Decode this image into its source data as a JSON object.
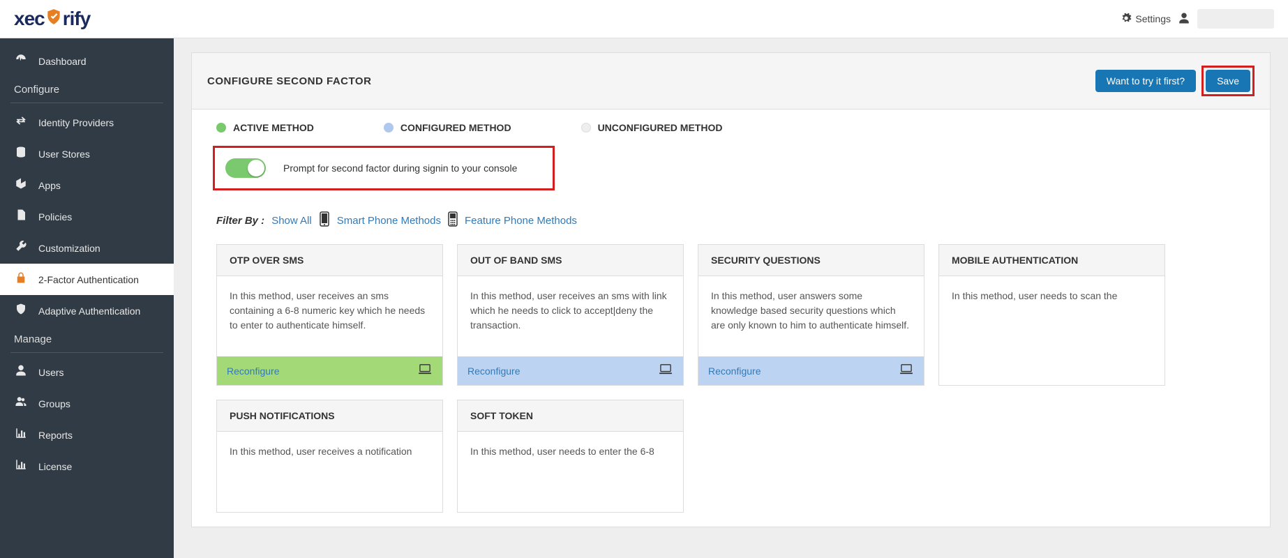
{
  "topbar": {
    "settings_label": "Settings",
    "logo_text_pre": "xec",
    "logo_text_post": "rify"
  },
  "sidebar": {
    "items": [
      {
        "icon": "dashboard",
        "label": "Dashboard"
      },
      {
        "section": "Configure"
      },
      {
        "icon": "exchange",
        "label": "Identity Providers"
      },
      {
        "icon": "db",
        "label": "User Stores"
      },
      {
        "icon": "cube",
        "label": "Apps"
      },
      {
        "icon": "doc",
        "label": "Policies"
      },
      {
        "icon": "wrench",
        "label": "Customization"
      },
      {
        "icon": "lock",
        "label": "2-Factor Authentication",
        "active": true
      },
      {
        "icon": "shield",
        "label": "Adaptive Authentication"
      },
      {
        "section": "Manage"
      },
      {
        "icon": "user",
        "label": "Users"
      },
      {
        "icon": "users",
        "label": "Groups"
      },
      {
        "icon": "chart",
        "label": "Reports"
      },
      {
        "icon": "chart",
        "label": "License"
      }
    ]
  },
  "panel": {
    "title": "CONFIGURE SECOND FACTOR",
    "try_button": "Want to try it first?",
    "save_button": "Save"
  },
  "legend": {
    "active": "ACTIVE METHOD",
    "configured": "CONFIGURED METHOD",
    "unconfigured": "UNCONFIGURED METHOD"
  },
  "prompt": {
    "text": "Prompt for second factor during signin to your console"
  },
  "filter": {
    "label": "Filter By :",
    "show_all": "Show All",
    "smart": "Smart Phone Methods",
    "feature": "Feature Phone Methods"
  },
  "cards": [
    {
      "title": "OTP OVER SMS",
      "body": "In this method, user receives an sms containing a 6-8 numeric key which he needs to enter to authenticate himself.",
      "action": "Reconfigure",
      "status": "active"
    },
    {
      "title": "OUT OF BAND SMS",
      "body": "In this method, user receives an sms with link which he needs to click to accept|deny the transaction.",
      "action": "Reconfigure",
      "status": "configured"
    },
    {
      "title": "SECURITY QUESTIONS",
      "body": "In this method, user answers some knowledge based security questions which are only known to him to authenticate himself.",
      "action": "Reconfigure",
      "status": "configured"
    },
    {
      "title": "MOBILE AUTHENTICATION",
      "body": "In this method, user needs to scan the",
      "action": "",
      "status": ""
    },
    {
      "title": "PUSH NOTIFICATIONS",
      "body": "In this method, user receives a notification",
      "action": "",
      "status": ""
    },
    {
      "title": "SOFT TOKEN",
      "body": "In this method, user needs to enter the 6-8",
      "action": "",
      "status": ""
    }
  ]
}
